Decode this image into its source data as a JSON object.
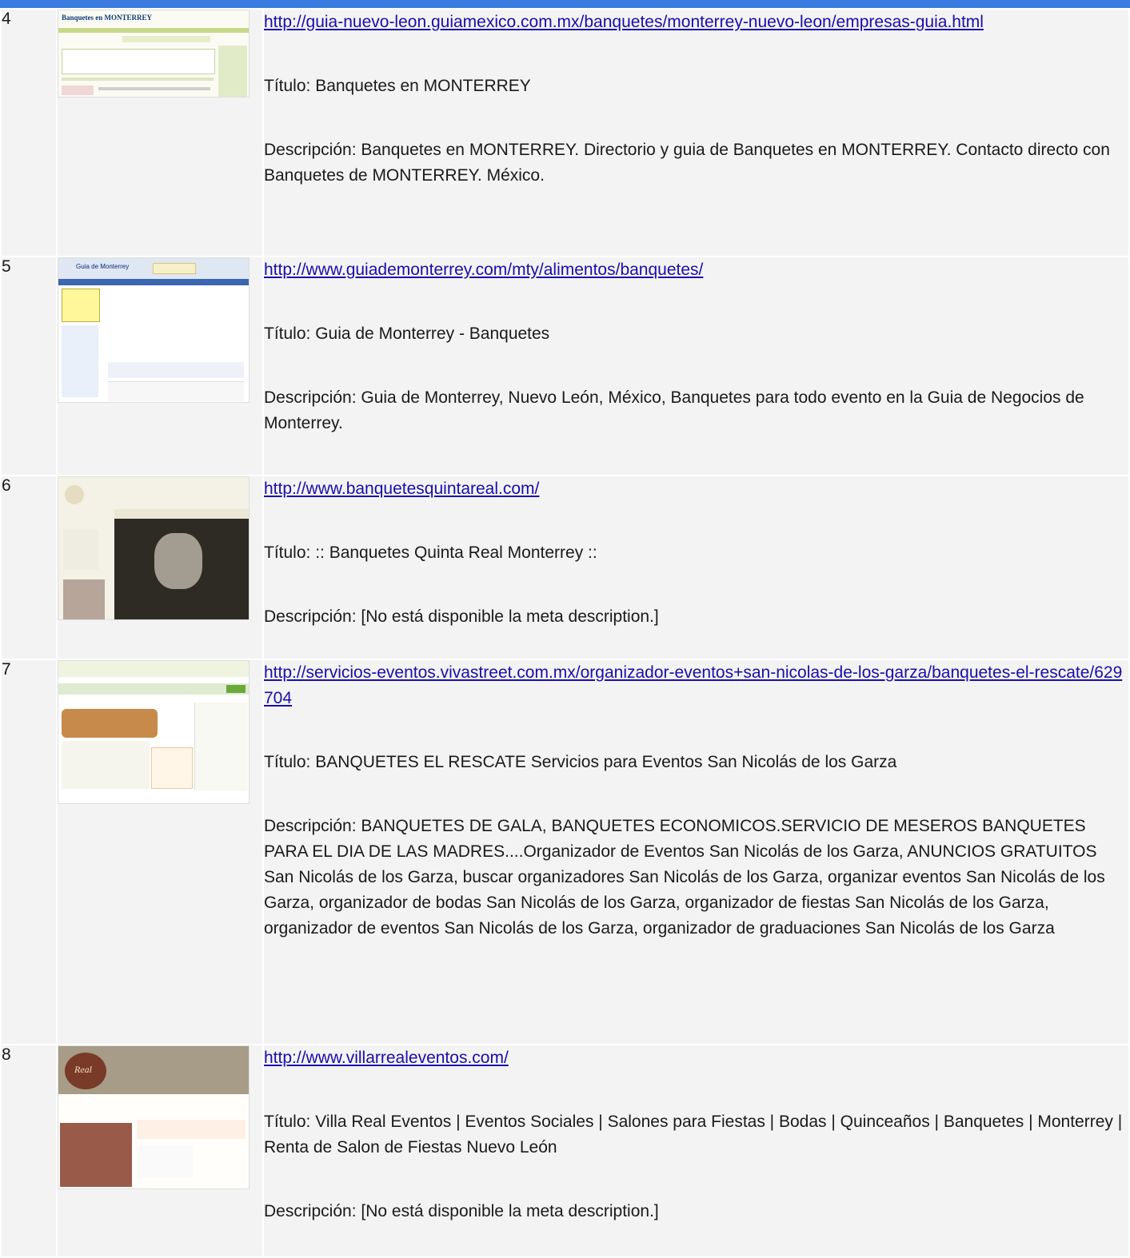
{
  "results": [
    {
      "num": "4",
      "url": "http://guia-nuevo-leon.guiamexico.com.mx/banquetes/monterrey-nuevo-leon/empresas-guia.html",
      "title": "Título: Banquetes en MONTERREY",
      "description": "Descripción: Banquetes en MONTERREY. Directorio y guia de Banquetes en MONTERREY. Contacto directo con Banquetes de MONTERREY. México.",
      "thumb_text": "Banquetes en MONTERREY"
    },
    {
      "num": "5",
      "url": "http://www.guiademonterrey.com/mty/alimentos/banquetes/",
      "title": "Título: Guia de Monterrey - Banquetes",
      "description": "Descripción: Guia de Monterrey, Nuevo León, México, Banquetes para todo evento en la Guia de Negocios de Monterrey.",
      "thumb_text": "Guia de Monterrey"
    },
    {
      "num": "6",
      "url": "http://www.banquetesquintareal.com/",
      "title": "Título: :: Banquetes Quinta Real Monterrey ::",
      "description": "Descripción: [No está disponible la meta description.]"
    },
    {
      "num": "7",
      "url": "http://servicios-eventos.vivastreet.com.mx/organizador-eventos+san-nicolas-de-los-garza/banquetes-el-rescate/629704",
      "title": "Título: BANQUETES EL RESCATE Servicios para Eventos San Nicolás de los Garza",
      "description": "Descripción: BANQUETES DE GALA, BANQUETES ECONOMICOS.SERVICIO DE MESEROS BANQUETES PARA EL DIA DE LAS MADRES....Organizador de Eventos San Nicolás de los Garza, ANUNCIOS GRATUITOS San Nicolás de los Garza, buscar organizadores San Nicolás de los Garza, organizar eventos San Nicolás de los Garza, organizador de bodas San Nicolás de los Garza, organizador de fiestas San Nicolás de los Garza, organizador de eventos San Nicolás de los Garza, organizador de graduaciones San Nicolás de los Garza"
    },
    {
      "num": "8",
      "url": "http://www.villarrealeventos.com/",
      "title": "Título: Villa Real Eventos | Eventos Sociales | Salones para Fiestas | Bodas | Quinceaños | Banquetes | Monterrey | Renta de Salon de Fiestas Nuevo León",
      "description": "Descripción: [No está disponible la meta description.]",
      "thumb_text": "Real"
    }
  ]
}
